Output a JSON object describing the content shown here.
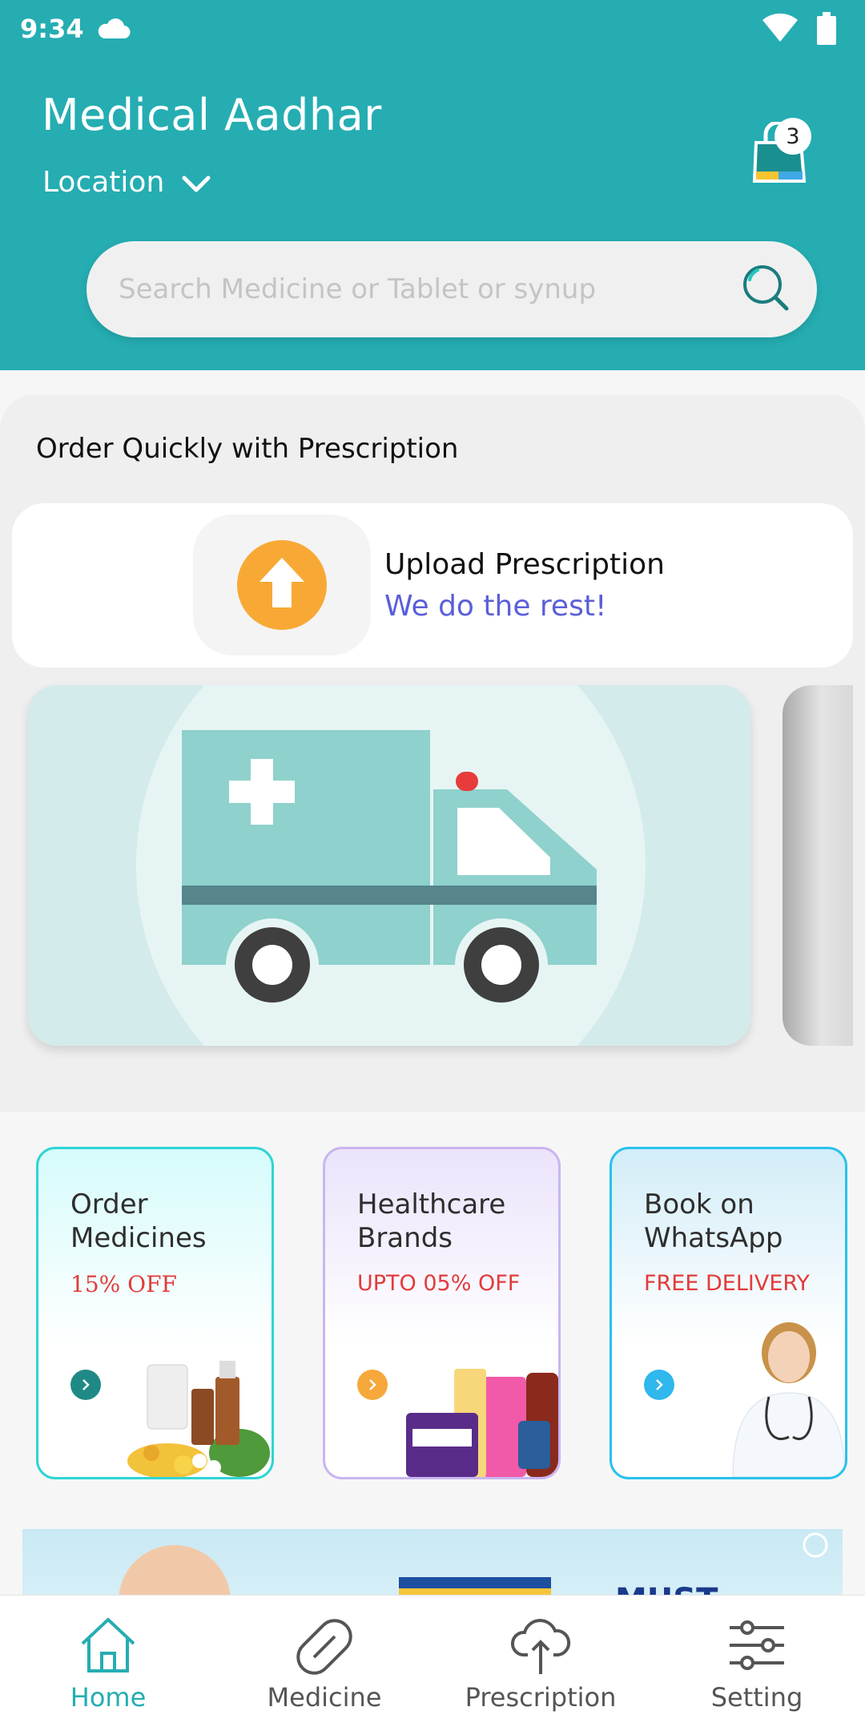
{
  "status_bar": {
    "time": "9:34"
  },
  "header": {
    "app_title": "Medical Aadhar",
    "location_label": "Location",
    "cart_count": "3"
  },
  "search": {
    "placeholder": "Search Medicine or Tablet or synup"
  },
  "prescription": {
    "section_title": "Order Quickly with Prescription",
    "upload_title": "Upload Prescription",
    "upload_subtitle": "We do the rest!"
  },
  "promos": [
    {
      "title": "Order Medicines",
      "offer": "15% OFF",
      "accent": "#1f8a85"
    },
    {
      "title": "Healthcare Brands",
      "offer": "UPTO 05% OFF",
      "accent": "#f6a83a"
    },
    {
      "title": "Book on WhatsApp",
      "offer": "FREE DELIVERY",
      "accent": "#2fb7ee"
    }
  ],
  "bottom_banner": {
    "text": "MUST HAVES"
  },
  "bottom_nav": [
    {
      "label": "Home",
      "icon": "home-icon",
      "active": true
    },
    {
      "label": "Medicine",
      "icon": "pill-icon",
      "active": false
    },
    {
      "label": "Prescription",
      "icon": "cloud-upload-icon",
      "active": false
    },
    {
      "label": "Setting",
      "icon": "sliders-icon",
      "active": false
    }
  ],
  "colors": {
    "primary": "#25adb2",
    "accent_blue": "#5a5fd8",
    "upload_orange": "#f8a935",
    "offer_red": "#e23b3b"
  }
}
